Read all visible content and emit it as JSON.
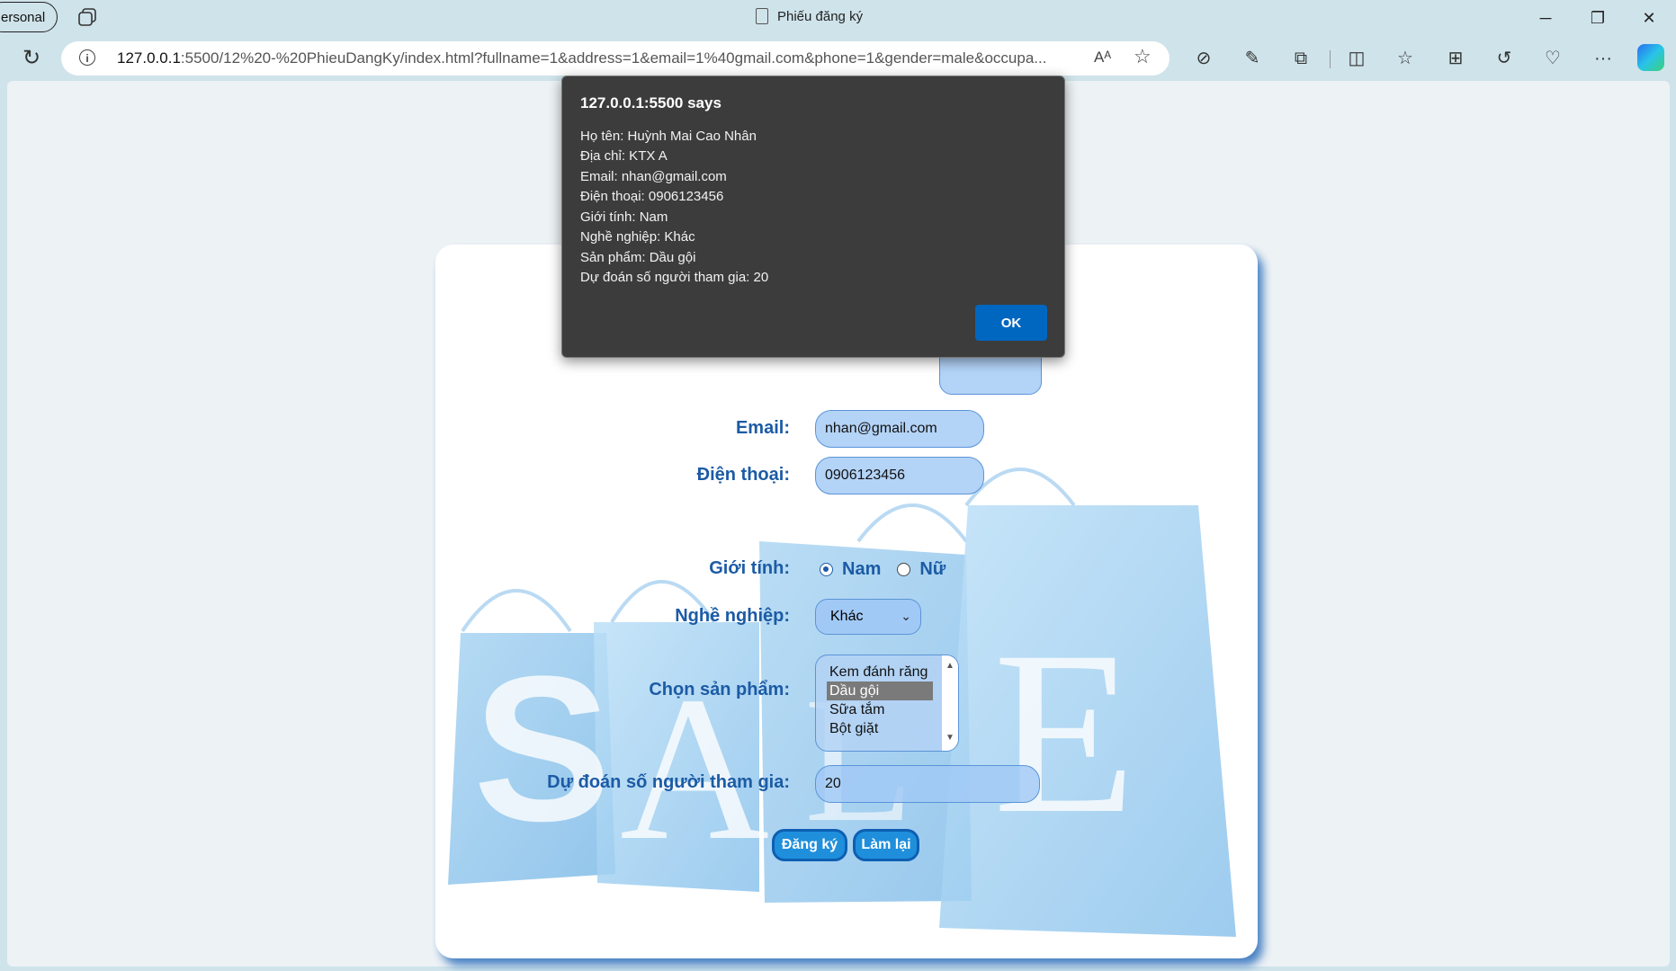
{
  "browser": {
    "profile_label": "ersonal",
    "tab_title": "Phiếu đăng ký",
    "url_host": "127.0.0.1",
    "url_rest": ":5500/12%20-%20PhieuDangKy/index.html?fullname=1&address=1&email=1%40gmail.com&phone=1&gender=male&occupa...",
    "read_aloud": "Aᴬ",
    "icons": [
      "tabs-icon",
      "reload-icon",
      "info-icon",
      "read-aloud-icon",
      "favorite-star-icon",
      "tracking-icon",
      "eyedropper-icon",
      "extensions-icon",
      "split-screen-icon",
      "favorites-icon",
      "collections-icon",
      "history-icon",
      "performance-icon",
      "more-icon",
      "copilot-icon",
      "minimize-icon",
      "restore-icon",
      "close-icon"
    ]
  },
  "form": {
    "labels": {
      "email": "Email:",
      "phone": "Điện thoại:",
      "gender": "Giới tính:",
      "occupation": "Nghề nghiệp:",
      "product": "Chọn sản phẩm:",
      "guess": "Dự đoán số người tham gia:"
    },
    "values": {
      "email": "nhan@gmail.com",
      "phone": "0906123456",
      "guess": "20"
    },
    "gender_options": [
      "Nam",
      "Nữ"
    ],
    "gender_selected": "Nam",
    "occupation_selected": "Khác",
    "products": [
      "Kem đánh răng",
      "Dầu gội",
      "Sữa tắm",
      "Bột giặt"
    ],
    "product_selected": "Dầu gội",
    "buttons": {
      "submit": "Đăng ký",
      "reset": "Làm lại"
    },
    "background_word": "SALE"
  },
  "dialog": {
    "title": "127.0.0.1:5500 says",
    "lines": [
      "Họ tên: Huỳnh Mai Cao Nhân",
      "Địa chỉ: KTX A",
      "Email: nhan@gmail.com",
      "Điện thoại: 0906123456",
      "Giới tính: Nam",
      "Nghề nghiệp: Khác",
      "Sản phẩm: Dầu gội",
      "Dự đoán số người tham gia: 20"
    ],
    "ok_label": "OK"
  }
}
